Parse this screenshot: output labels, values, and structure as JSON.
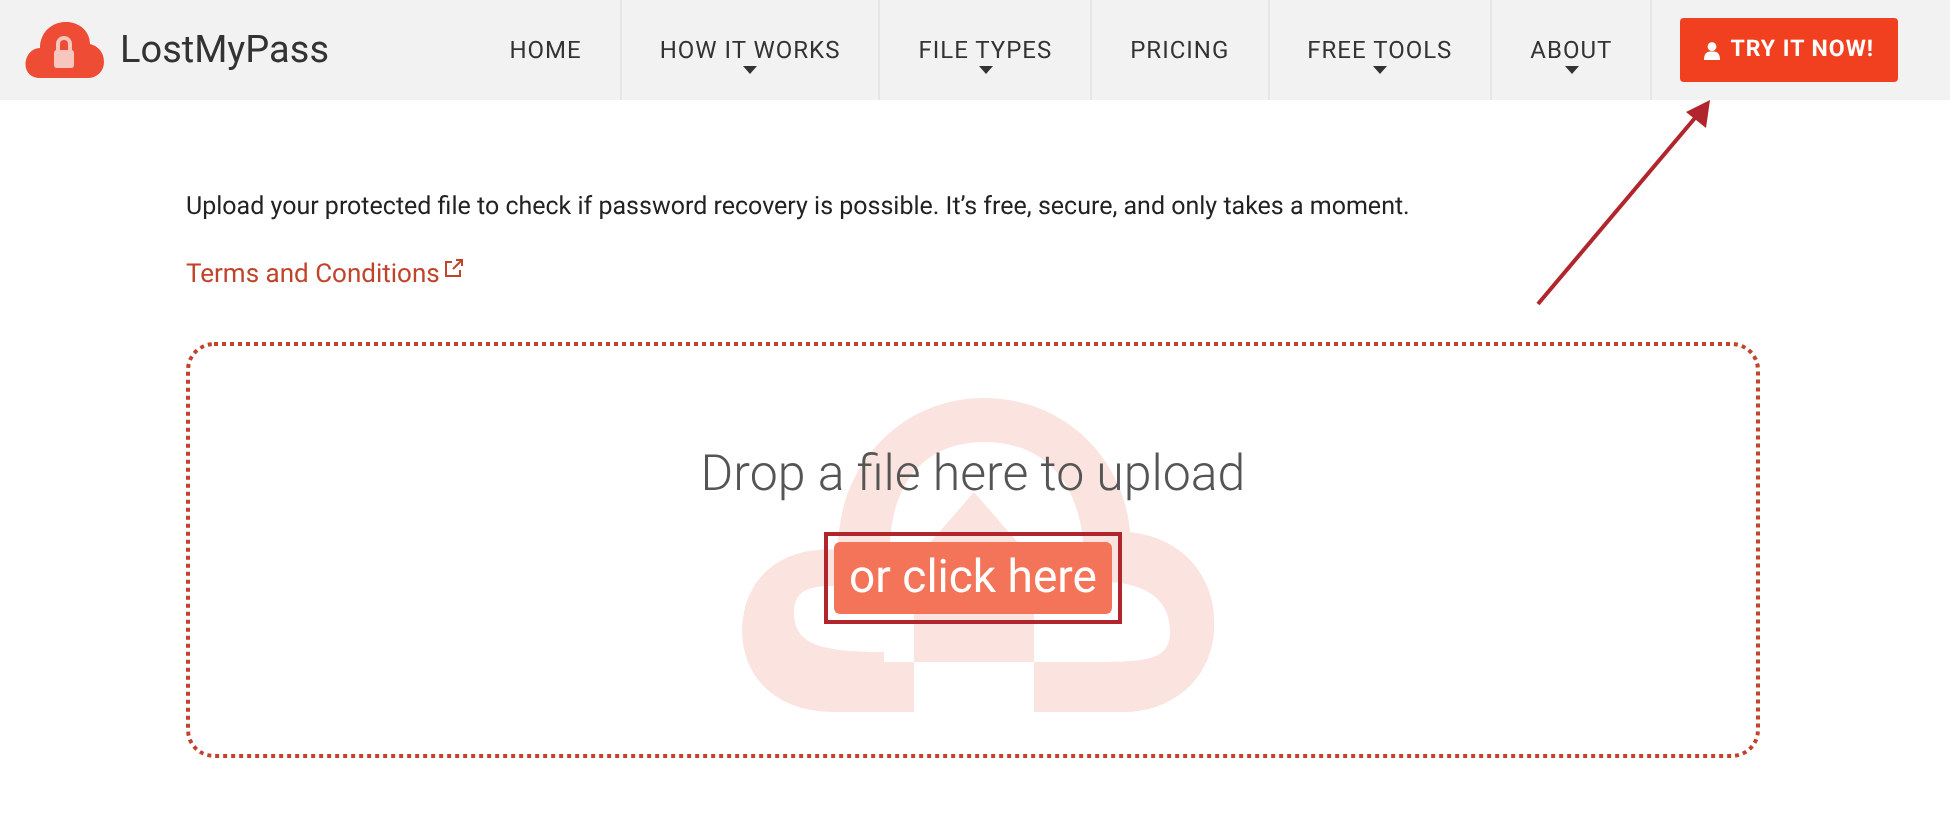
{
  "header": {
    "logo_text": "LostMyPass",
    "nav": [
      {
        "label": "HOME",
        "dropdown": false
      },
      {
        "label": "HOW IT WORKS",
        "dropdown": true
      },
      {
        "label": "FILE TYPES",
        "dropdown": true
      },
      {
        "label": "PRICING",
        "dropdown": false
      },
      {
        "label": "FREE TOOLS",
        "dropdown": true
      },
      {
        "label": "ABOUT",
        "dropdown": true
      }
    ],
    "cta": "TRY IT NOW!"
  },
  "intro": "Upload your protected file to check if password recovery is possible. It’s free, secure, and only takes a moment.",
  "terms_link": "Terms and Conditions",
  "upload": {
    "title": "Drop a file here to upload",
    "button": "or click here",
    "highlighted": true
  },
  "annotation_arrow": true
}
